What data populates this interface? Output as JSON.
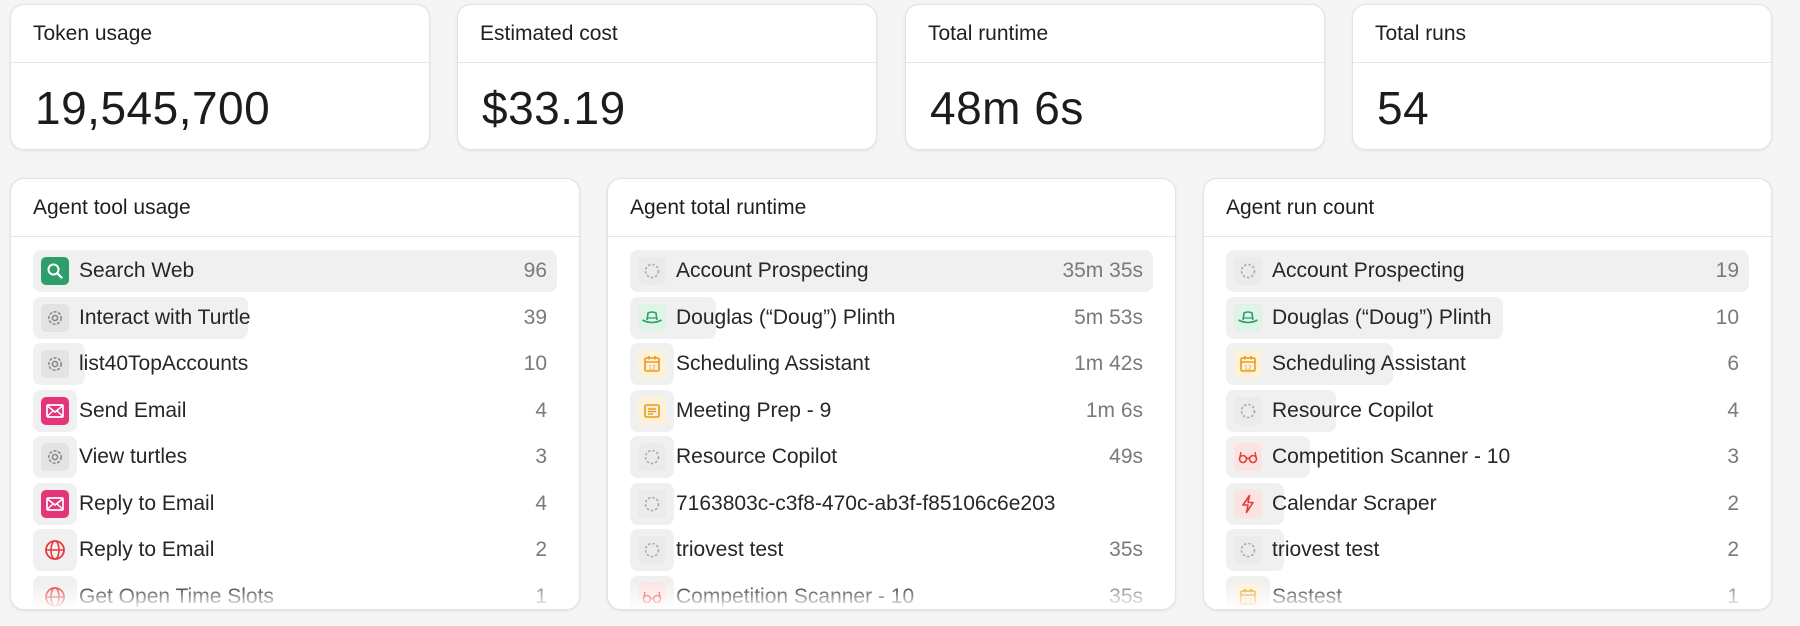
{
  "stats": [
    {
      "title": "Token usage",
      "value": "19,545,700"
    },
    {
      "title": "Estimated cost",
      "value": "$33.19"
    },
    {
      "title": "Total runtime",
      "value": "48m 6s"
    },
    {
      "title": "Total runs",
      "value": "54"
    }
  ],
  "tool_usage": {
    "title": "Agent tool usage",
    "items": [
      {
        "icon": "search-icon",
        "label": "Search Web",
        "value": "96",
        "fill": 1.0
      },
      {
        "icon": "gear-icon",
        "label": "Interact with Turtle",
        "value": "39",
        "fill": 0.41
      },
      {
        "icon": "gear-icon",
        "label": "list40TopAccounts",
        "value": "10",
        "fill": 0.1
      },
      {
        "icon": "mail-icon",
        "label": "Send Email",
        "value": "4",
        "fill": 0.04
      },
      {
        "icon": "gear-icon",
        "label": "View turtles",
        "value": "3",
        "fill": 0.03
      },
      {
        "icon": "mail-icon",
        "label": "Reply to Email",
        "value": "4",
        "fill": 0.04
      },
      {
        "icon": "globe-icon",
        "label": "Reply to Email",
        "value": "2",
        "fill": 0.02
      },
      {
        "icon": "globe-icon",
        "label": "Get Open Time Slots",
        "value": "1",
        "fill": 0.01
      }
    ]
  },
  "total_runtime": {
    "title": "Agent total runtime",
    "items": [
      {
        "icon": "agent-icon",
        "label": "Account Prospecting",
        "value": "35m 35s",
        "fill": 1.0
      },
      {
        "icon": "hat-icon",
        "label": "Douglas (“Doug”) Plinth",
        "value": "5m 53s",
        "fill": 0.165
      },
      {
        "icon": "calendar-icon",
        "label": "Scheduling Assistant",
        "value": "1m 42s",
        "fill": 0.048
      },
      {
        "icon": "newspaper-icon",
        "label": "Meeting Prep - 9",
        "value": "1m 6s",
        "fill": 0.031
      },
      {
        "icon": "agent-icon",
        "label": "Resource Copilot",
        "value": "49s",
        "fill": 0.023
      },
      {
        "icon": "agent-icon",
        "label": "7163803c-c3f8-470c-ab3f-f85106c6e203",
        "value": "",
        "fill": 0.02
      },
      {
        "icon": "agent-icon",
        "label": "triovest test",
        "value": "35s",
        "fill": 0.016
      },
      {
        "icon": "glasses-icon",
        "label": "Competition Scanner - 10",
        "value": "35s",
        "fill": 0.016
      }
    ]
  },
  "run_count": {
    "title": "Agent run count",
    "items": [
      {
        "icon": "agent-icon",
        "label": "Account Prospecting",
        "value": "19",
        "fill": 1.0
      },
      {
        "icon": "hat-icon",
        "label": "Douglas (“Doug”) Plinth",
        "value": "10",
        "fill": 0.53
      },
      {
        "icon": "calendar-icon",
        "label": "Scheduling Assistant",
        "value": "6",
        "fill": 0.32
      },
      {
        "icon": "agent-icon",
        "label": "Resource Copilot",
        "value": "4",
        "fill": 0.21
      },
      {
        "icon": "glasses-icon",
        "label": "Competition Scanner - 10",
        "value": "3",
        "fill": 0.16
      },
      {
        "icon": "bolt-icon",
        "label": "Calendar Scraper",
        "value": "2",
        "fill": 0.11
      },
      {
        "icon": "agent-icon",
        "label": "triovest test",
        "value": "2",
        "fill": 0.11
      },
      {
        "icon": "calendar-icon",
        "label": "Sastest",
        "value": "1",
        "fill": 0.05
      }
    ]
  }
}
